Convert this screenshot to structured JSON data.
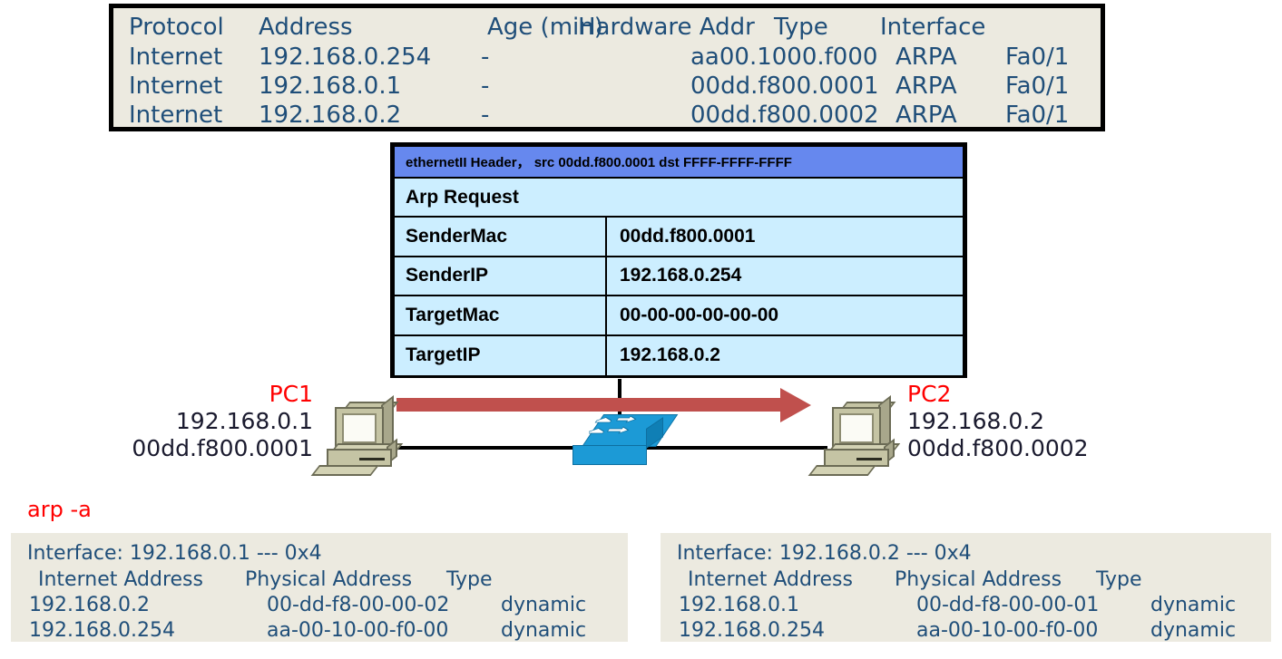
{
  "router_arp_table": {
    "name": "router-arp-table",
    "columns": [
      "Protocol",
      "Address",
      "Age (min)",
      "Hardware Addr",
      "Type",
      "Interface"
    ],
    "rows": [
      [
        "Internet",
        "192.168.0.254",
        "-",
        "aa00.1000.f000",
        "ARPA",
        "Fa0/1"
      ],
      [
        "Internet",
        "192.168.0.1",
        "-",
        "00dd.f800.0001",
        "ARPA",
        "Fa0/1"
      ],
      [
        "Internet",
        "192.168.0.2",
        "-",
        "00dd.f800.0002",
        "ARPA",
        "Fa0/1"
      ]
    ],
    "background_color": "#ECEAE0",
    "text_color": "#1F4E79",
    "border_color": "#000000"
  },
  "arp_packet": {
    "name": "arp-packet-detail",
    "ethernet_header": "ethernetII Header， src 00dd.f800.0001 dst FFFF-FFFF-FFFF",
    "operation": "Arp Request",
    "fields": [
      {
        "key": "SenderMac",
        "value": "00dd.f800.0001"
      },
      {
        "key": "SenderIP",
        "value": "192.168.0.254"
      },
      {
        "key": "TargetMac",
        "value": "00-00-00-00-00-00"
      },
      {
        "key": "TargetIP",
        "value": "192.168.0.2"
      }
    ],
    "header_color": "#6688EE",
    "body_color": "#CCEEFF"
  },
  "topology": {
    "pc1": {
      "name": "PC1",
      "ip": "192.168.0.1",
      "mac": "00dd.f800.0001"
    },
    "pc2": {
      "name": "PC2",
      "ip": "192.168.0.2",
      "mac": "00dd.f800.0002"
    },
    "switch": {
      "icon": "switch-icon"
    },
    "flow_arrow": {
      "direction": "left-to-right",
      "color": "#C0504D"
    },
    "name_color": "#FF0000"
  },
  "arp_command": {
    "label": "arp -a",
    "color": "#FF0000"
  },
  "host_arp_caches": [
    {
      "name": "host-arp-cache-pc1",
      "interface_line": "Interface: 192.168.0.1 --- 0x4",
      "columns": [
        "Internet Address",
        "Physical Address",
        "Type"
      ],
      "rows": [
        [
          "192.168.0.2",
          "00-dd-f8-00-00-02",
          "dynamic"
        ],
        [
          "192.168.0.254",
          "aa-00-10-00-f0-00",
          "dynamic"
        ]
      ]
    },
    {
      "name": "host-arp-cache-pc2",
      "interface_line": "Interface: 192.168.0.2 --- 0x4",
      "columns": [
        "Internet Address",
        "Physical Address",
        "Type"
      ],
      "rows": [
        [
          "192.168.0.1",
          "00-dd-f8-00-00-01",
          "dynamic"
        ],
        [
          "192.168.0.254",
          "aa-00-10-00-f0-00",
          "dynamic"
        ]
      ]
    }
  ]
}
